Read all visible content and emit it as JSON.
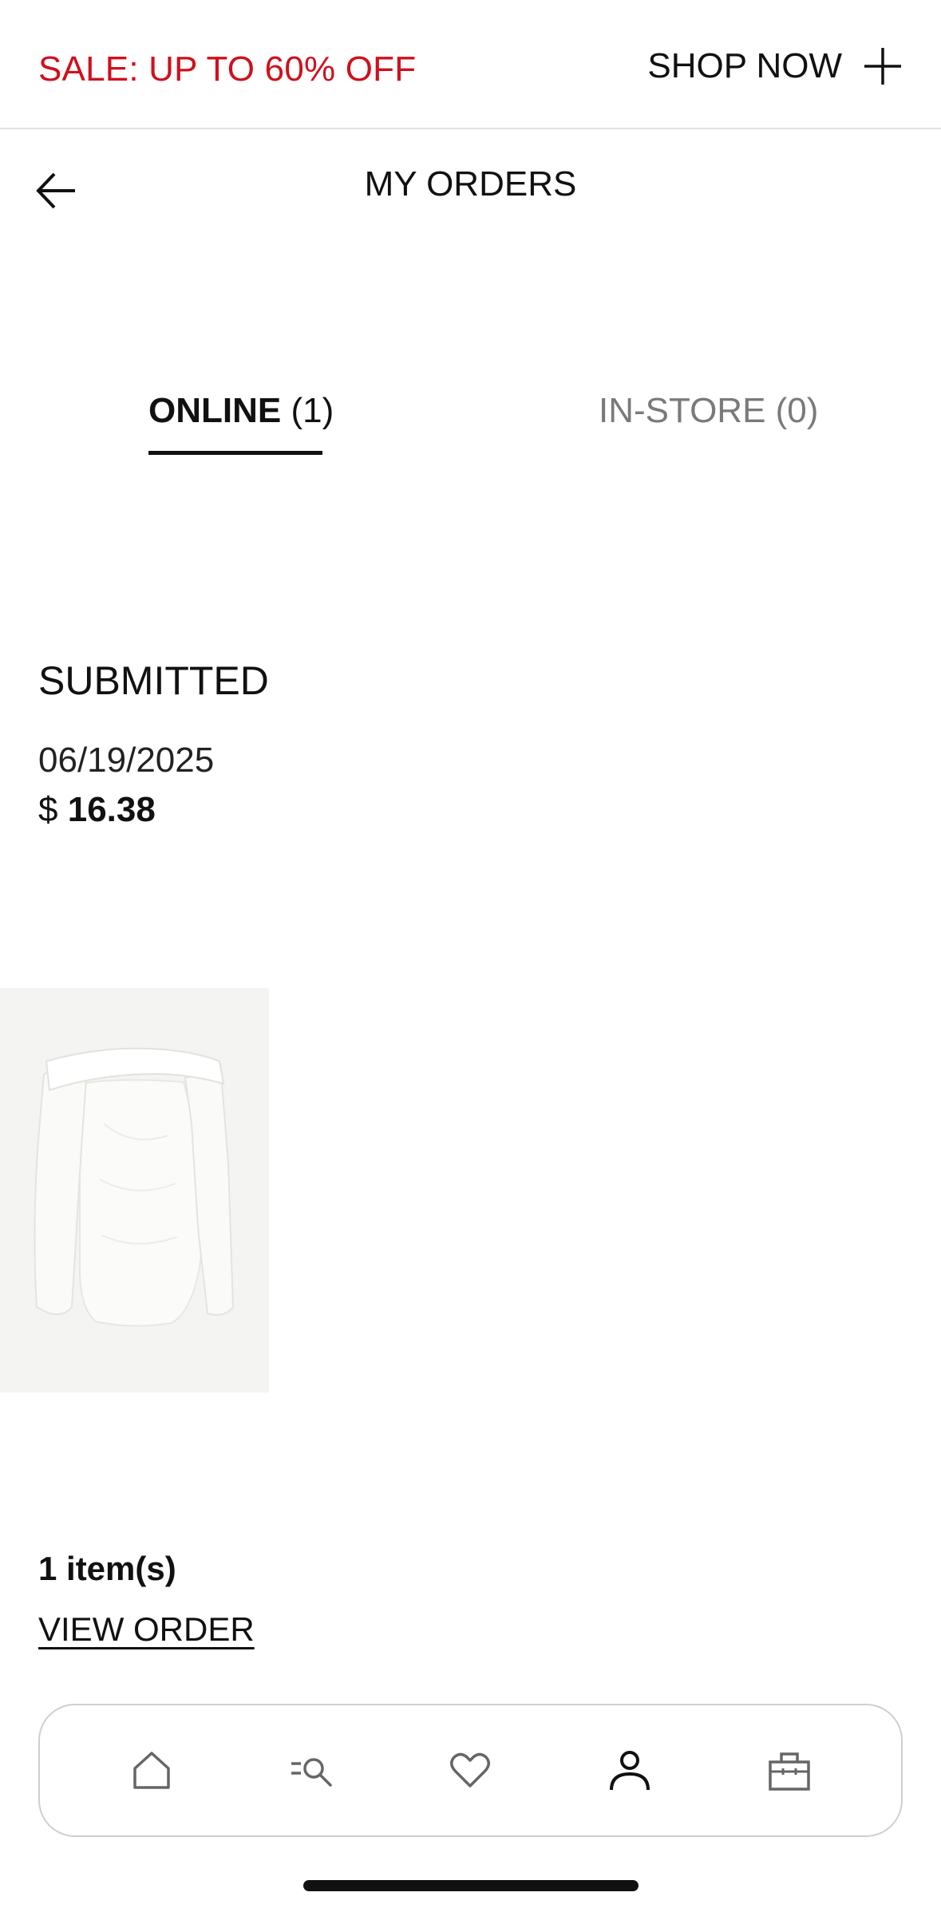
{
  "promo": {
    "text": "SALE: UP TO 60% OFF",
    "cta": "SHOP NOW",
    "text_color": "#d0101d"
  },
  "header": {
    "title": "MY ORDERS",
    "back_icon": "arrow-left-icon"
  },
  "tabs": [
    {
      "label": "ONLINE",
      "count": "(1)",
      "active": true
    },
    {
      "label": "IN-STORE (0)",
      "active": false
    }
  ],
  "order": {
    "status": "SUBMITTED",
    "date": "06/19/2025",
    "currency": "$",
    "total": "16.38",
    "product_image": "white off-shoulder long-sleeve top",
    "item_count": "1 item(s)",
    "view_label": "VIEW ORDER"
  },
  "bottom_nav": [
    {
      "icon": "home-icon",
      "active": false
    },
    {
      "icon": "menu-search-icon",
      "active": false
    },
    {
      "icon": "heart-icon",
      "active": false
    },
    {
      "icon": "account-icon",
      "active": true
    },
    {
      "icon": "shopping-bag-icon",
      "active": false
    }
  ]
}
